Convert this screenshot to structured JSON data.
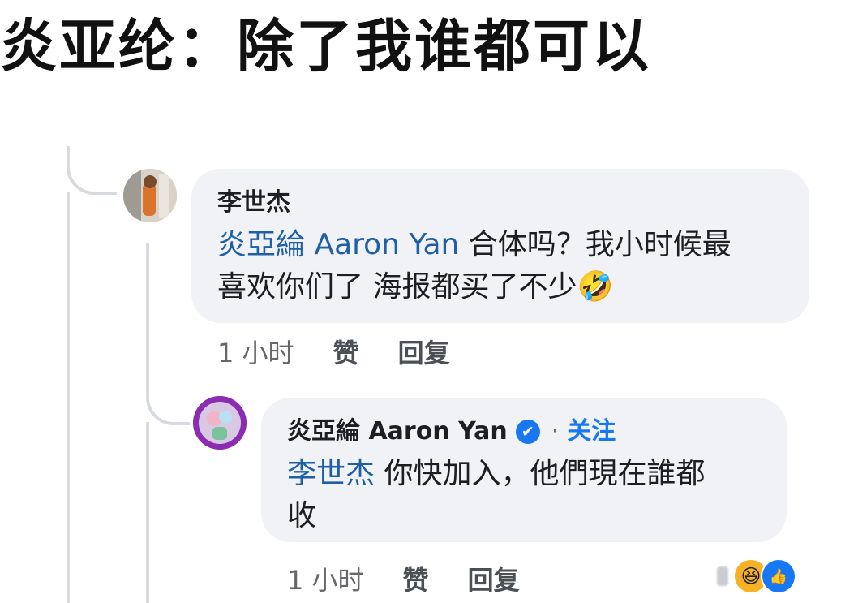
{
  "headline": "炎亚纶：除了我谁都可以",
  "comments": [
    {
      "author": "李世杰",
      "mention": "炎亞綸 Aaron Yan",
      "text_line1": " 合体吗？我小时候最",
      "text_line2": "喜欢你们了 海报都买了不少",
      "emoji": "🤣",
      "time": "1 小时",
      "like_label": "赞",
      "reply_label": "回复"
    },
    {
      "author": "炎亞綸 Aaron Yan",
      "verified_glyph": "✔",
      "separator": "·",
      "follow_label": "关注",
      "mention": "李世杰",
      "text_line1": " 你快加入，他們現在誰都",
      "text_line2": "收",
      "time": "1 小时",
      "like_label": "赞",
      "reply_label": "回复",
      "reaction_icons": [
        "haha-reaction-icon",
        "like-reaction-icon"
      ]
    }
  ],
  "colors": {
    "mention": "#1f5fa8",
    "follow": "#1877f2",
    "bubble": "#f0f2f5"
  }
}
